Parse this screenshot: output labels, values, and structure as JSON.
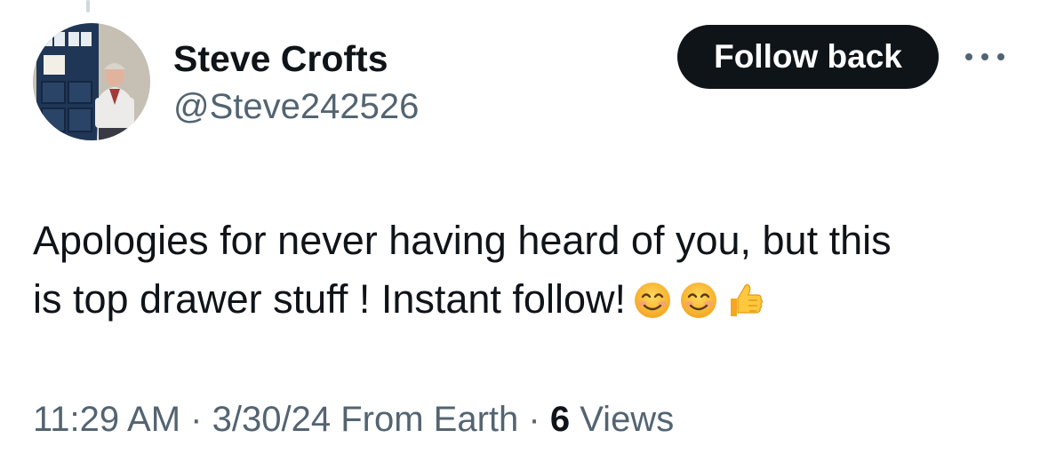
{
  "author": {
    "display_name": "Steve Crofts",
    "handle": "@Steve242526"
  },
  "actions": {
    "follow_label": "Follow back",
    "more_icon": "more-horizontal-icon"
  },
  "tweet": {
    "text_line_1": "Apologies for never having heard of you, but this",
    "text_line_2": "is top drawer stuff ! Instant follow!",
    "emojis": [
      "smiling-face-icon",
      "smiling-face-icon",
      "thumbs-up-icon"
    ]
  },
  "meta": {
    "time": "11:29 AM",
    "separator": "·",
    "date": "3/30/24",
    "source": "From Earth",
    "views_count": "6",
    "views_label": "Views"
  },
  "colors": {
    "text_primary": "#0f1419",
    "text_secondary": "#536471",
    "button_bg": "#0f1419",
    "button_text": "#ffffff",
    "emoji_yellow": "#ffc83d"
  }
}
